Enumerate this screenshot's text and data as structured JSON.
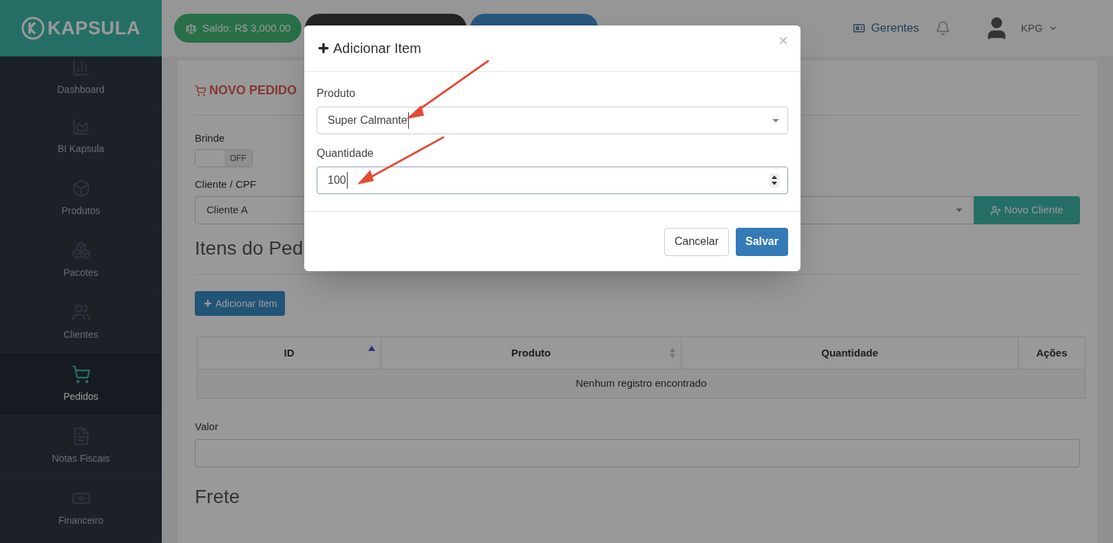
{
  "brand": {
    "name": "KAPSULA"
  },
  "topbar": {
    "balance_button": "Saldo: R$ 3,000.00",
    "managers_link": "Gerentes",
    "user": "KPG"
  },
  "sidebar": {
    "items": [
      {
        "label": "Dashboard",
        "kind": "bars",
        "selected": false
      },
      {
        "label": "BI Kapsula",
        "kind": "area",
        "selected": false
      },
      {
        "label": "Produtos",
        "kind": "box",
        "selected": false
      },
      {
        "label": "Pacotes",
        "kind": "boxes",
        "selected": false
      },
      {
        "label": "Clientes",
        "kind": "users",
        "selected": false
      },
      {
        "label": "Pedidos",
        "kind": "cart",
        "selected": true
      },
      {
        "label": "Notas Fiscais",
        "kind": "file",
        "selected": false
      },
      {
        "label": "Financeiro",
        "kind": "money",
        "selected": false
      }
    ]
  },
  "page": {
    "title": "NOVO PEDIDO",
    "brinde": {
      "label": "Brinde",
      "toggle_text": "OFF",
      "on": false
    },
    "cliente": {
      "label": "Cliente / CPF",
      "value": "Cliente A",
      "new_button": "Novo Cliente"
    },
    "items_heading": "Itens do Ped",
    "add_button": "Adicionar Item",
    "table": {
      "columns": [
        {
          "label": "ID",
          "sortable": true,
          "sorted": true
        },
        {
          "label": "Produto",
          "sortable": true,
          "sorted": false
        },
        {
          "label": "Quantidade",
          "sortable": false
        },
        {
          "label": "Ações",
          "sortable": false
        }
      ],
      "empty_text": "Nenhum registro encontrado"
    },
    "valor": {
      "label": "Valor"
    },
    "frete_heading": "Frete"
  },
  "modal": {
    "title": "Adicionar Item",
    "close": "×",
    "fields": [
      {
        "label": "Produto",
        "kind": "select",
        "value": "Super Calmante"
      },
      {
        "label": "Quantidade",
        "kind": "number",
        "value": "100"
      }
    ],
    "buttons": [
      {
        "label": "Cancelar",
        "kind": "default"
      },
      {
        "label": "Salvar",
        "kind": "primary"
      }
    ]
  }
}
